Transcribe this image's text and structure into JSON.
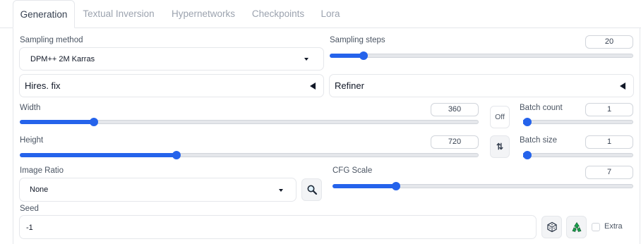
{
  "tabs": [
    {
      "label": "Generation"
    },
    {
      "label": "Textual Inversion"
    },
    {
      "label": "Hypernetworks"
    },
    {
      "label": "Checkpoints"
    },
    {
      "label": "Lora"
    }
  ],
  "sampling_method": {
    "label": "Sampling method",
    "value": "DPM++ 2M Karras"
  },
  "sampling_steps": {
    "label": "Sampling steps",
    "value": "20",
    "fraction": 0.11
  },
  "hires_fix": {
    "label": "Hires. fix"
  },
  "refiner": {
    "label": "Refiner"
  },
  "width": {
    "label": "Width",
    "value": "360",
    "fraction": 0.16
  },
  "height": {
    "label": "Height",
    "value": "720",
    "fraction": 0.34
  },
  "toggle_button": {
    "label": "Off"
  },
  "swap_button": {
    "label": "⇅"
  },
  "batch_count": {
    "label": "Batch count",
    "value": "1",
    "fraction": 0.0
  },
  "batch_size": {
    "label": "Batch size",
    "value": "1",
    "fraction": 0.0
  },
  "image_ratio": {
    "label": "Image Ratio",
    "value": "None"
  },
  "cfg_scale": {
    "label": "CFG Scale",
    "value": "7",
    "fraction": 0.21
  },
  "seed": {
    "label": "Seed",
    "value": "-1"
  },
  "extra": {
    "label": "Extra"
  },
  "colors": {
    "accent": "#2563eb",
    "track": "#e5e7eb",
    "border": "#e5e7eb"
  }
}
